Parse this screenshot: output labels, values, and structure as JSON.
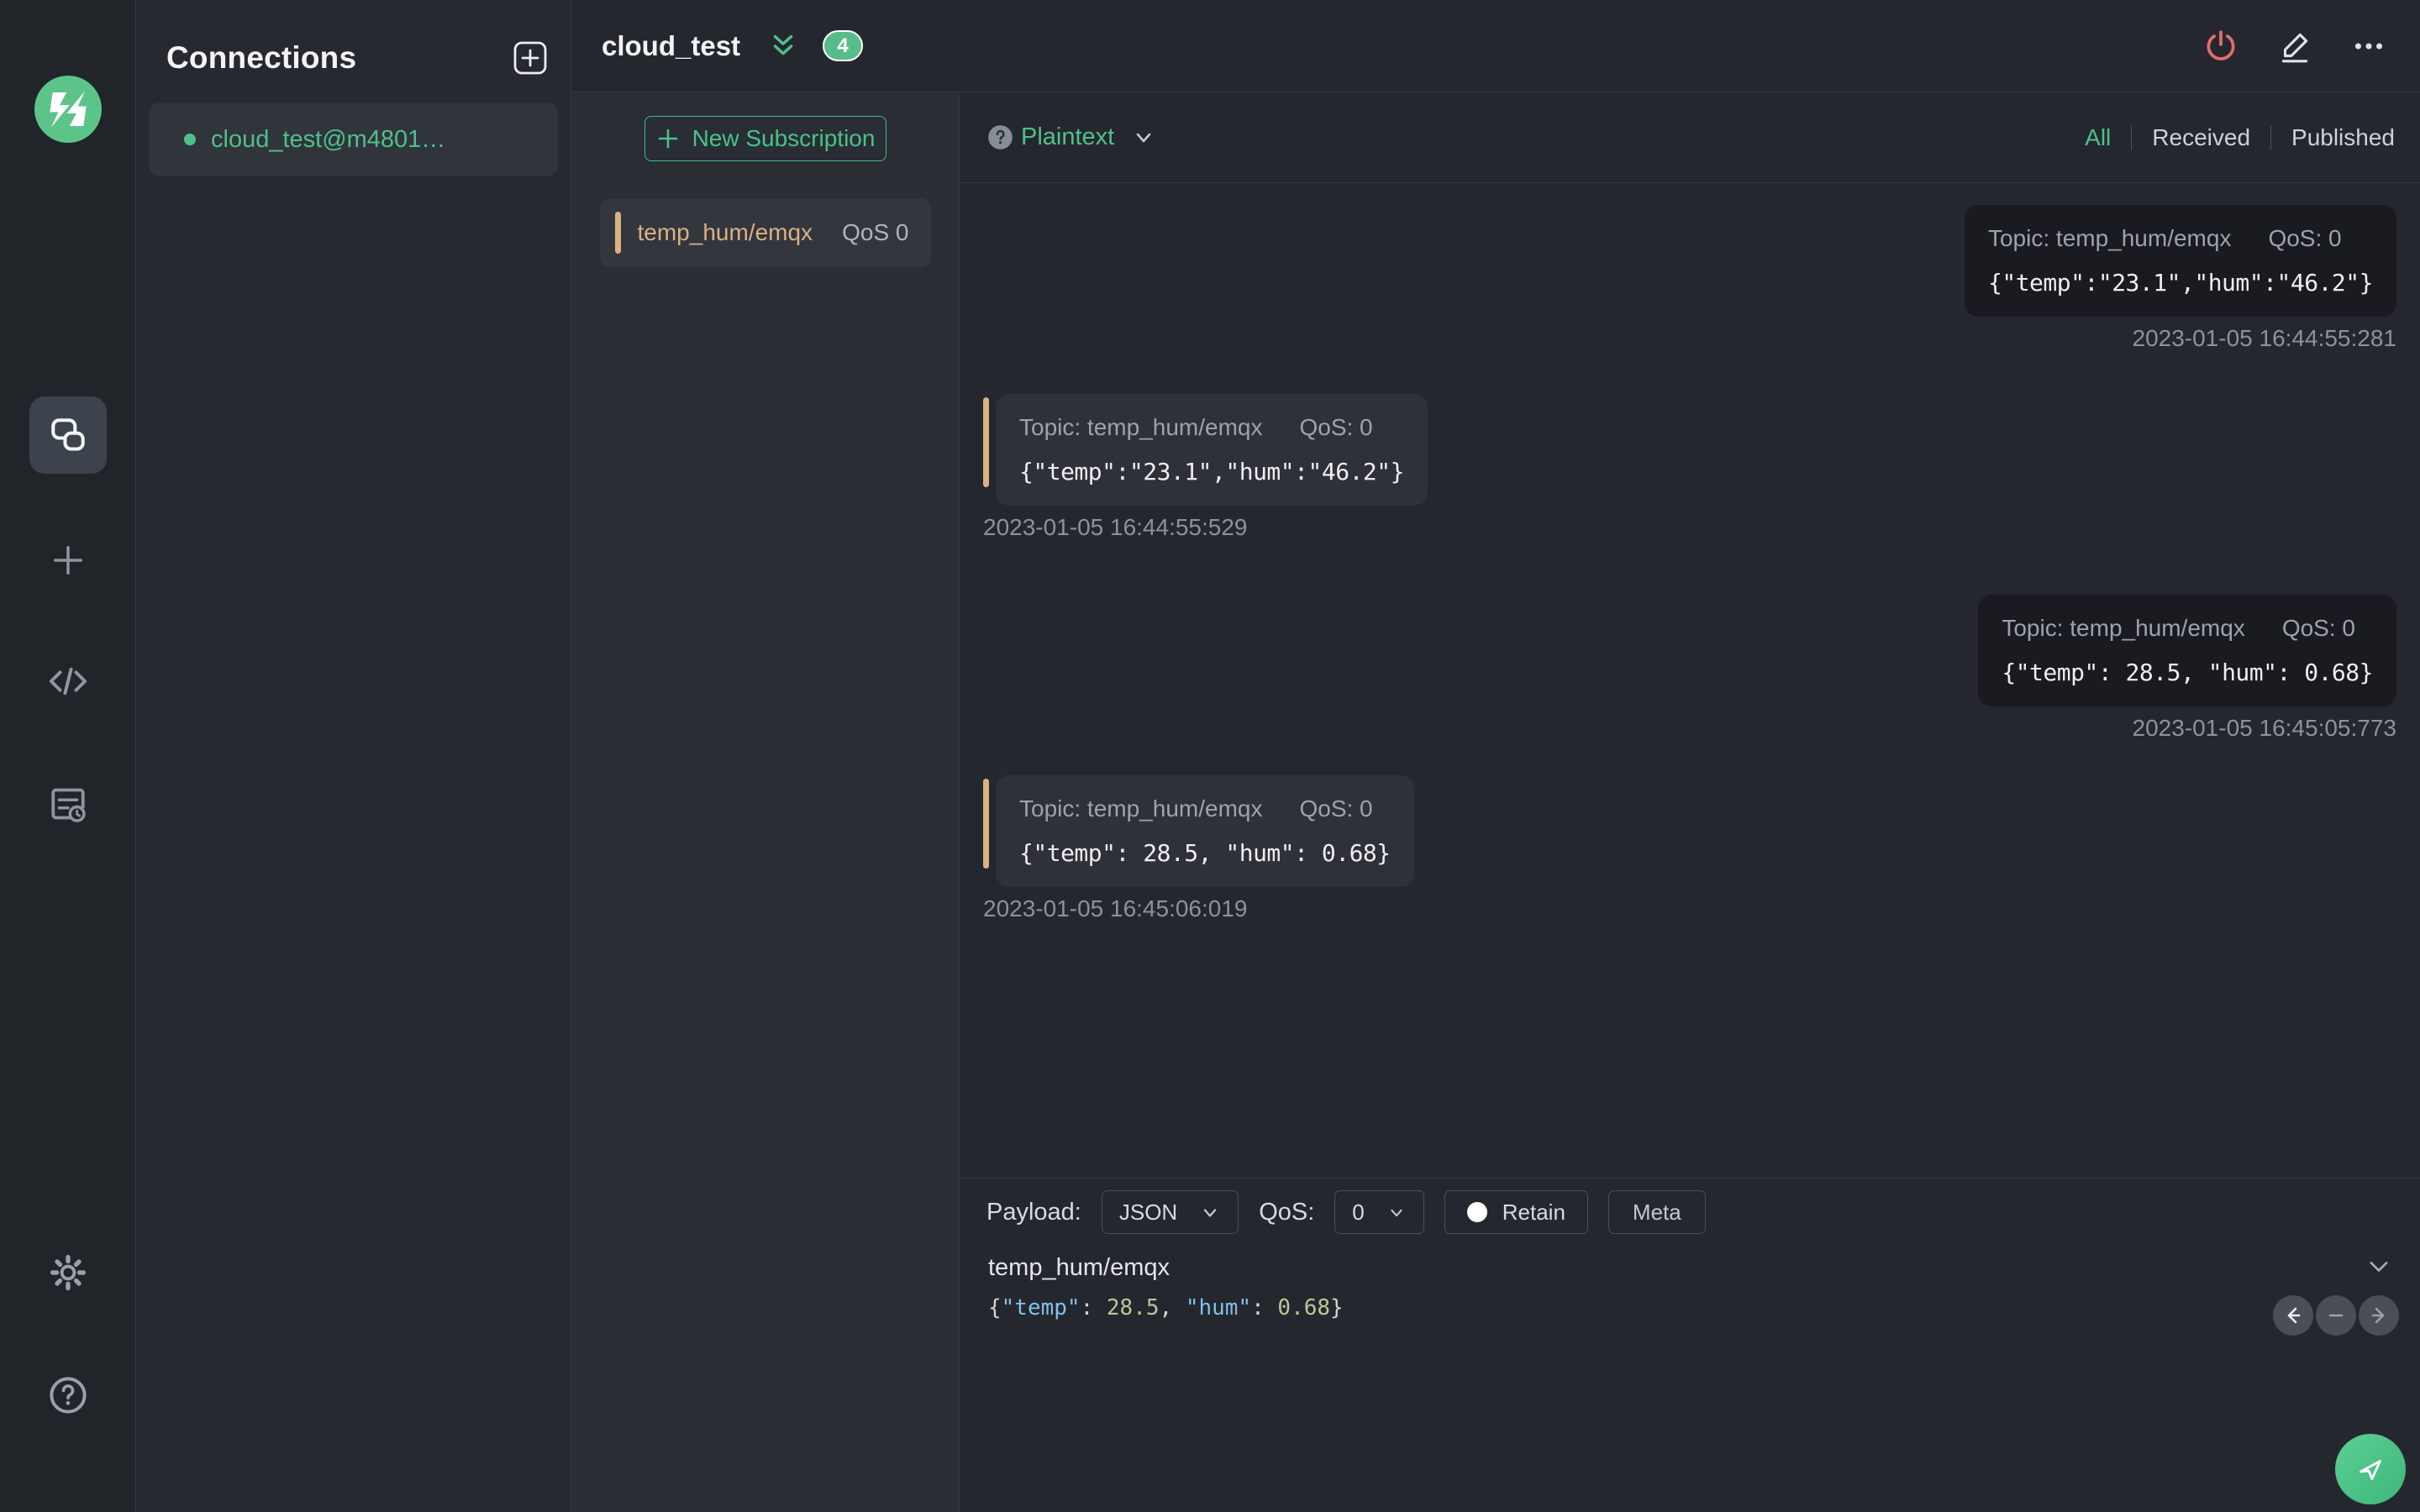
{
  "app": {
    "accent_green": "#4fc08a",
    "accent_tan": "#d8b185",
    "danger_red": "#e06e6c"
  },
  "connections_panel": {
    "title": "Connections",
    "items": [
      {
        "name": "cloud_test@m4801…",
        "status": "connected"
      }
    ]
  },
  "header": {
    "title": "cloud_test",
    "unread_badge": "4"
  },
  "subscriptions": {
    "new_button_label": "New Subscription",
    "items": [
      {
        "topic": "temp_hum/emqx",
        "qos_label": "QoS 0"
      }
    ]
  },
  "messages": {
    "format_label": "Plaintext",
    "filters": [
      {
        "label": "All",
        "active": true
      },
      {
        "label": "Received",
        "active": false
      },
      {
        "label": "Published",
        "active": false
      }
    ],
    "items": [
      {
        "direction": "published",
        "topic_label": "Topic: temp_hum/emqx",
        "qos_label": "QoS: 0",
        "payload": "{\"temp\":\"23.1\",\"hum\":\"46.2\"}",
        "timestamp": "2023-01-05 16:44:55:281"
      },
      {
        "direction": "received",
        "topic_label": "Topic: temp_hum/emqx",
        "qos_label": "QoS: 0",
        "payload": "{\"temp\":\"23.1\",\"hum\":\"46.2\"}",
        "timestamp": "2023-01-05 16:44:55:529"
      },
      {
        "direction": "published",
        "topic_label": "Topic: temp_hum/emqx",
        "qos_label": "QoS: 0",
        "payload": "{\"temp\": 28.5, \"hum\": 0.68}",
        "timestamp": "2023-01-05 16:45:05:773"
      },
      {
        "direction": "received",
        "topic_label": "Topic: temp_hum/emqx",
        "qos_label": "QoS: 0",
        "payload": "{\"temp\": 28.5, \"hum\": 0.68}",
        "timestamp": "2023-01-05 16:45:06:019"
      }
    ]
  },
  "composer": {
    "payload_label": "Payload:",
    "payload_format_value": "JSON",
    "qos_label": "QoS:",
    "qos_value": "0",
    "retain_label": "Retain",
    "meta_label": "Meta",
    "topic_value": "temp_hum/emqx",
    "payload_tokens": [
      {
        "t": "punc",
        "v": "{"
      },
      {
        "t": "key",
        "v": "\"temp\""
      },
      {
        "t": "punc",
        "v": ": "
      },
      {
        "t": "num",
        "v": "28.5"
      },
      {
        "t": "punc",
        "v": ", "
      },
      {
        "t": "key",
        "v": "\"hum\""
      },
      {
        "t": "punc",
        "v": ": "
      },
      {
        "t": "num",
        "v": "0.68"
      },
      {
        "t": "punc",
        "v": "}"
      }
    ]
  }
}
